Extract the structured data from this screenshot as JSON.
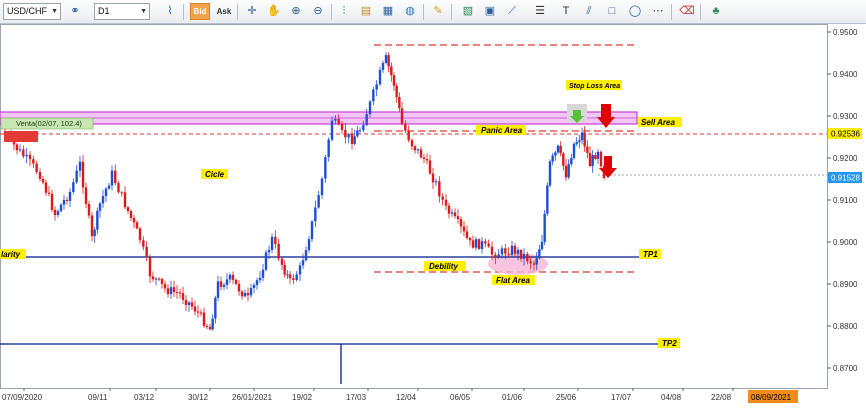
{
  "toolbar": {
    "symbol": "USD/CHF",
    "timeframe": "D1",
    "bid_label": "Bid",
    "ask_label": "Ask"
  },
  "chart": {
    "price_axis": [
      "0.9500",
      "0.9400",
      "0.9300",
      "0.9200",
      "0.9100",
      "0.9000",
      "0.8900",
      "0.8800",
      "0.8700"
    ],
    "date_axis": [
      "07/09/2020",
      "09/11",
      "03/12",
      "30/12",
      "26/01/2021",
      "19/02",
      "17/03",
      "12/04",
      "06/05",
      "01/06",
      "25/06",
      "17/07",
      "04/08",
      "22/08"
    ],
    "highlight_date": "08/09/2021",
    "current_price": "0.91528",
    "level_price": "0.92536",
    "order_label": "Venta(02/07, 102.4)",
    "annotations": {
      "sell_area": "Sell Area",
      "stop_loss_area": "Stop Loss Area",
      "panic_area": "Panic Area",
      "cicle": "Cicle",
      "debility": "Debility",
      "flat_area": "Flat Area",
      "tp1": "TP1",
      "tp2": "TP2",
      "larity": "larity"
    },
    "colors": {
      "bull": "#1f4fd1",
      "bear": "#d81b1b",
      "sell_zone": "#e07ce6",
      "resistance": "#e53935",
      "support": "#001a8c",
      "label_bg": "#ffef00"
    }
  }
}
